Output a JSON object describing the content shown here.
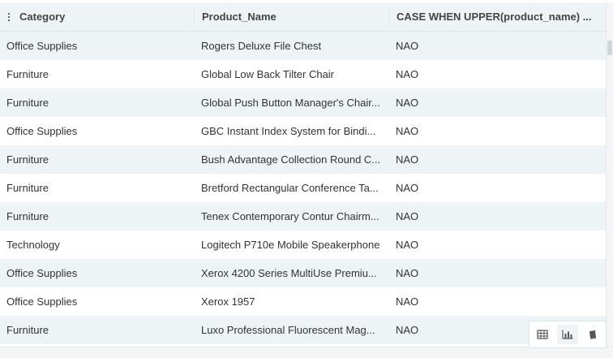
{
  "columns": [
    "Category",
    "Product_Name",
    "CASE WHEN UPPER(product_name) ..."
  ],
  "rows": [
    {
      "category": "Office Supplies",
      "product": "Rogers Deluxe File Chest",
      "case": "NAO"
    },
    {
      "category": "Furniture",
      "product": "Global Low Back Tilter Chair",
      "case": "NAO"
    },
    {
      "category": "Furniture",
      "product": "Global Push Button Manager's Chair...",
      "case": "NAO"
    },
    {
      "category": "Office Supplies",
      "product": "GBC Instant Index System for Bindi...",
      "case": "NAO"
    },
    {
      "category": "Furniture",
      "product": "Bush Advantage Collection Round C...",
      "case": "NAO"
    },
    {
      "category": "Furniture",
      "product": "Bretford Rectangular Conference Ta...",
      "case": "NAO"
    },
    {
      "category": "Furniture",
      "product": "Tenex Contemporary Contur Chairm...",
      "case": "NAO"
    },
    {
      "category": "Technology",
      "product": "Logitech P710e Mobile Speakerphone",
      "case": "NAO"
    },
    {
      "category": "Office Supplies",
      "product": "Xerox 4200 Series MultiUse Premiu...",
      "case": "NAO"
    },
    {
      "category": "Office Supplies",
      "product": "Xerox 1957",
      "case": "NAO"
    },
    {
      "category": "Furniture",
      "product": "Luxo Professional Fluorescent Mag...",
      "case": "NAO"
    }
  ],
  "toolbar": {
    "icons": [
      "table-view-icon",
      "bar-chart-icon",
      "notebook-icon"
    ],
    "active": "bar-chart-icon"
  },
  "colors": {
    "stripe": "#eef3f5",
    "icon": "#555555"
  }
}
